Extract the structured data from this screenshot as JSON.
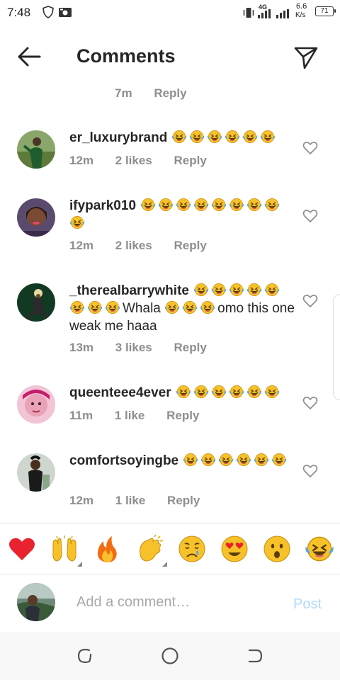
{
  "status_bar": {
    "time": "7:48",
    "network": "4G",
    "speed_value": "6.6",
    "speed_unit": "K/s",
    "battery": "71"
  },
  "header": {
    "title": "Comments",
    "back_icon": "arrow-left-icon",
    "send_icon": "paper-plane-icon"
  },
  "top_partial": {
    "time": "7m",
    "reply_label": "Reply"
  },
  "comments": [
    {
      "username": "er_luxurybrand",
      "text": "",
      "emoji_count": 6,
      "time": "12m",
      "likes": "2 likes",
      "reply_label": "Reply"
    },
    {
      "username": "ifypark010",
      "text": "",
      "emoji_count": 9,
      "time": "12m",
      "likes": "2 likes",
      "reply_label": "Reply"
    },
    {
      "username": "_therealbarrywhite",
      "text_part1": "Whala",
      "text_part2": "omo this one weak me haaa",
      "time": "13m",
      "likes": "3 likes",
      "reply_label": "Reply"
    },
    {
      "username": "queenteee4ever",
      "text": "",
      "emoji_count": 6,
      "time": "11m",
      "likes": "1 like",
      "reply_label": "Reply"
    },
    {
      "username": "comfortsoyingbe",
      "text": "",
      "emoji_count": 6,
      "time": "12m",
      "likes": "1 like",
      "reply_label": "Reply"
    }
  ],
  "reactions": [
    "red-heart-icon",
    "raising-hands-icon",
    "fire-icon",
    "clapping-hands-icon",
    "crying-face-icon",
    "heart-eyes-icon",
    "astonished-face-icon",
    "tears-of-joy-icon"
  ],
  "composer": {
    "placeholder": "Add a comment…",
    "post_label": "Post"
  },
  "colors": {
    "text": "#262626",
    "muted": "#8e8e8e",
    "post_disabled": "#b3dbff",
    "emoji_yellow": "#f7c12a",
    "emoji_tear": "#4ea5f2"
  }
}
